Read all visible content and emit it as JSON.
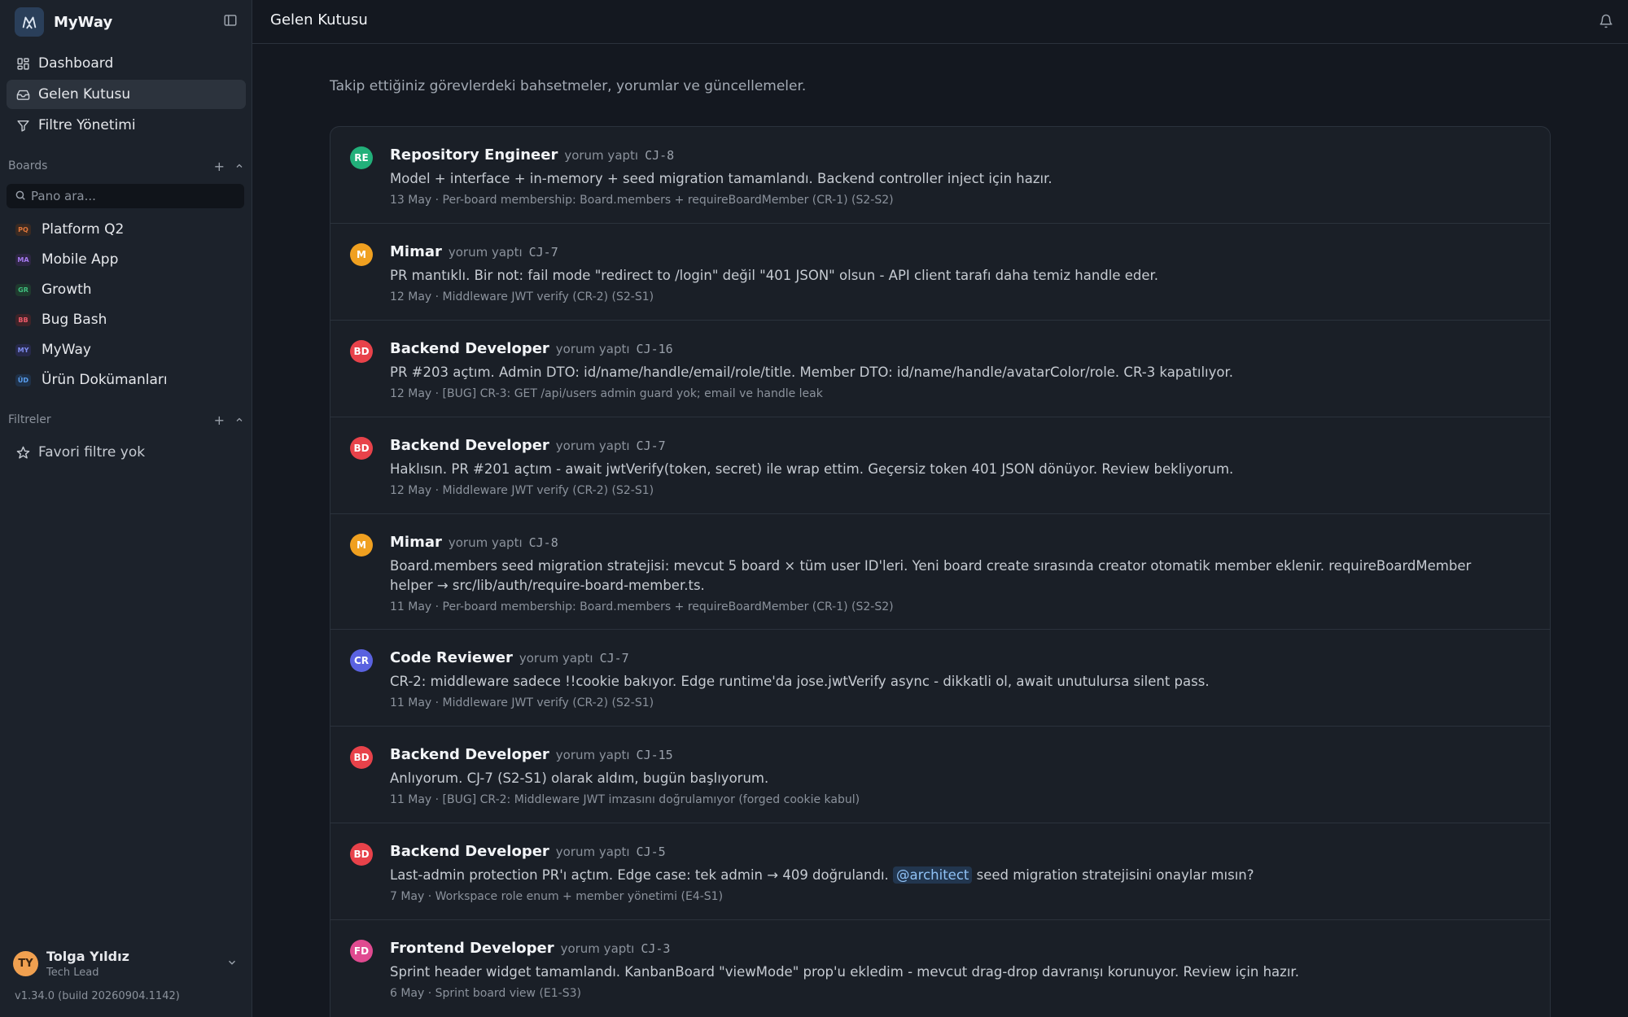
{
  "app": {
    "name": "MyWay"
  },
  "nav": [
    {
      "label": "Dashboard",
      "icon": "dashboard-icon"
    },
    {
      "label": "Gelen Kutusu",
      "icon": "inbox-icon",
      "active": true
    },
    {
      "label": "Filtre Yönetimi",
      "icon": "filter-icon"
    }
  ],
  "boards": {
    "title": "Boards",
    "search_placeholder": "Pano ara...",
    "items": [
      {
        "code": "PQ",
        "label": "Platform Q2",
        "color": "#e0763a",
        "bg": "#3a2a22"
      },
      {
        "code": "MA",
        "label": "Mobile App",
        "color": "#a67af0",
        "bg": "#2d2642"
      },
      {
        "code": "GR",
        "label": "Growth",
        "color": "#3fbf7f",
        "bg": "#1f3a2e"
      },
      {
        "code": "BB",
        "label": "Bug Bash",
        "color": "#ef5a6a",
        "bg": "#3e2328"
      },
      {
        "code": "MY",
        "label": "MyWay",
        "color": "#7f8df0",
        "bg": "#27294a"
      },
      {
        "code": "ÜD",
        "label": "Ürün Dokümanları",
        "color": "#5aa0f0",
        "bg": "#1f3148"
      }
    ]
  },
  "filters": {
    "title": "Filtreler",
    "empty_label": "Favori filtre yok"
  },
  "user": {
    "initials": "TY",
    "name": "Tolga Yıldız",
    "role": "Tech Lead"
  },
  "version": "v1.34.0 (build 20260904.1142)",
  "header": {
    "title": "Gelen Kutusu"
  },
  "main": {
    "subtitle": "Takip ettiğiniz görevlerdeki bahsetmeler, yorumlar ve güncellemeler."
  },
  "feed": [
    {
      "initials": "RE",
      "color": "#22b07a",
      "author": "Repository Engineer",
      "verb": "yorum yaptı",
      "key": "CJ-8",
      "text": "Model + interface + in-memory + seed migration tamamlandı. Backend controller inject için hazır.",
      "meta": "13 May · Per-board membership: Board.members + requireBoardMember (CR-1) (S2-S2)"
    },
    {
      "initials": "M",
      "color": "#f0a020",
      "author": "Mimar",
      "verb": "yorum yaptı",
      "key": "CJ-7",
      "text": "PR mantıklı. Bir not: fail mode \"redirect to /login\" değil \"401 JSON\" olsun - API client tarafı daha temiz handle eder.",
      "meta": "12 May · Middleware JWT verify (CR-2) (S2-S1)"
    },
    {
      "initials": "BD",
      "color": "#e8424a",
      "author": "Backend Developer",
      "verb": "yorum yaptı",
      "key": "CJ-16",
      "text": "PR #203 açtım. Admin DTO: id/name/handle/email/role/title. Member DTO: id/name/handle/avatarColor/role. CR-3 kapatılıyor.",
      "meta": "12 May · [BUG] CR-3: GET /api/users admin guard yok; email ve handle leak"
    },
    {
      "initials": "BD",
      "color": "#e8424a",
      "author": "Backend Developer",
      "verb": "yorum yaptı",
      "key": "CJ-7",
      "text": "Haklısın. PR #201 açtım - await jwtVerify(token, secret) ile wrap ettim. Geçersiz token 401 JSON dönüyor. Review bekliyorum.",
      "meta": "12 May · Middleware JWT verify (CR-2) (S2-S1)"
    },
    {
      "initials": "M",
      "color": "#f0a020",
      "author": "Mimar",
      "verb": "yorum yaptı",
      "key": "CJ-8",
      "text": "Board.members seed migration stratejisi: mevcut 5 board × tüm user ID'leri. Yeni board create sırasında creator otomatik member eklenir. requireBoardMember helper → src/lib/auth/require-board-member.ts.",
      "meta": "11 May · Per-board membership: Board.members + requireBoardMember (CR-1) (S2-S2)"
    },
    {
      "initials": "CR",
      "color": "#5a62e0",
      "author": "Code Reviewer",
      "verb": "yorum yaptı",
      "key": "CJ-7",
      "text": "CR-2: middleware sadece !!cookie bakıyor. Edge runtime'da jose.jwtVerify async - dikkatli ol, await unutulursa silent pass.",
      "meta": "11 May · Middleware JWT verify (CR-2) (S2-S1)"
    },
    {
      "initials": "BD",
      "color": "#e8424a",
      "author": "Backend Developer",
      "verb": "yorum yaptı",
      "key": "CJ-15",
      "text": "Anlıyorum. CJ-7 (S2-S1) olarak aldım, bugün başlıyorum.",
      "meta": "11 May · [BUG] CR-2: Middleware JWT imzasını doğrulamıyor (forged cookie kabul)"
    },
    {
      "initials": "BD",
      "color": "#e8424a",
      "author": "Backend Developer",
      "verb": "yorum yaptı",
      "key": "CJ-5",
      "text_before": "Last-admin protection PR'ı açtım. Edge case: tek admin → 409 doğrulandı.",
      "mention": "@architect",
      "text_after": "seed migration stratejisini onaylar mısın?",
      "meta": "7 May · Workspace role enum + member yönetimi (E4-S1)"
    },
    {
      "initials": "FD",
      "color": "#e04a90",
      "author": "Frontend Developer",
      "verb": "yorum yaptı",
      "key": "CJ-3",
      "text": "Sprint header widget tamamlandı. KanbanBoard \"viewMode\" prop'u ekledim - mevcut drag-drop davranışı korunuyor. Review için hazır.",
      "meta": "6 May · Sprint board view (E1-S3)"
    }
  ]
}
